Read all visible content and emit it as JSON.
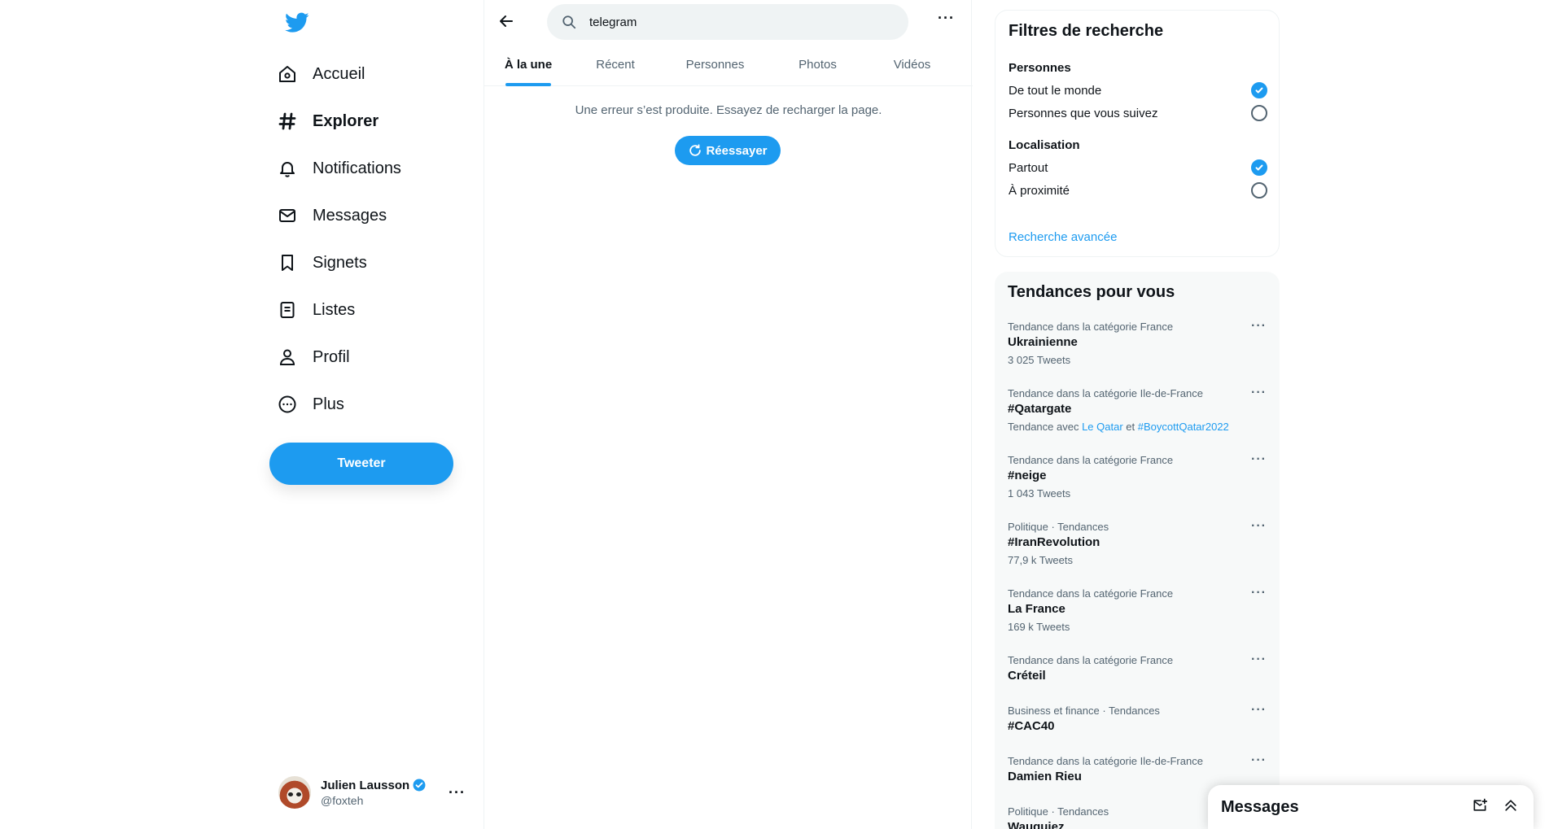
{
  "nav": {
    "items": [
      {
        "label": "Accueil",
        "icon": "home-icon"
      },
      {
        "label": "Explorer",
        "icon": "hashtag-icon"
      },
      {
        "label": "Notifications",
        "icon": "bell-icon"
      },
      {
        "label": "Messages",
        "icon": "envelope-icon"
      },
      {
        "label": "Signets",
        "icon": "bookmark-icon"
      },
      {
        "label": "Listes",
        "icon": "list-icon"
      },
      {
        "label": "Profil",
        "icon": "person-icon"
      },
      {
        "label": "Plus",
        "icon": "more-circle-icon"
      }
    ],
    "active": "Explorer",
    "tweet_label": "Tweeter"
  },
  "account": {
    "name": "Julien Lausson",
    "handle": "@foxteh"
  },
  "search": {
    "query": "telegram"
  },
  "tabs": [
    "À la une",
    "Récent",
    "Personnes",
    "Photos",
    "Vidéos"
  ],
  "active_tab": "À la une",
  "main": {
    "error": "Une erreur s’est produite. Essayez de recharger la page.",
    "retry_label": "Réessayer"
  },
  "filters": {
    "title": "Filtres de recherche",
    "people_heading": "Personnes",
    "people_options": [
      {
        "label": "De tout le monde",
        "checked": true
      },
      {
        "label": "Personnes que vous suivez",
        "checked": false
      }
    ],
    "location_heading": "Localisation",
    "location_options": [
      {
        "label": "Partout",
        "checked": true
      },
      {
        "label": "À proximité",
        "checked": false
      }
    ],
    "advanced_link": "Recherche avancée"
  },
  "trends": {
    "title": "Tendances pour vous",
    "items": [
      {
        "meta": "Tendance dans la catégorie France",
        "title": "Ukrainienne",
        "sub": "3 025 Tweets"
      },
      {
        "meta": "Tendance dans la catégorie Ile-de-France",
        "title": "#Qatargate",
        "sub_prefix": "Tendance avec",
        "sub_link1": "Le Qatar",
        "sub_mid": "et",
        "sub_link2": "#BoycottQatar2022"
      },
      {
        "meta": "Tendance dans la catégorie France",
        "title": "#neige",
        "sub": "1 043 Tweets"
      },
      {
        "meta": "Politique · Tendances",
        "title": "#IranRevolution",
        "sub": "77,9 k Tweets"
      },
      {
        "meta": "Tendance dans la catégorie France",
        "title": "La France",
        "sub": "169 k Tweets"
      },
      {
        "meta": "Tendance dans la catégorie France",
        "title": "Créteil"
      },
      {
        "meta": "Business et finance · Tendances",
        "title": "#CAC40"
      },
      {
        "meta": "Tendance dans la catégorie Ile-de-France",
        "title": "Damien Rieu"
      },
      {
        "meta": "Politique · Tendances",
        "title": "Wauquiez"
      }
    ]
  },
  "messages_drawer": {
    "title": "Messages"
  },
  "colors": {
    "accent": "#1d9bf0",
    "text": "#0f1419",
    "muted": "#536471"
  }
}
